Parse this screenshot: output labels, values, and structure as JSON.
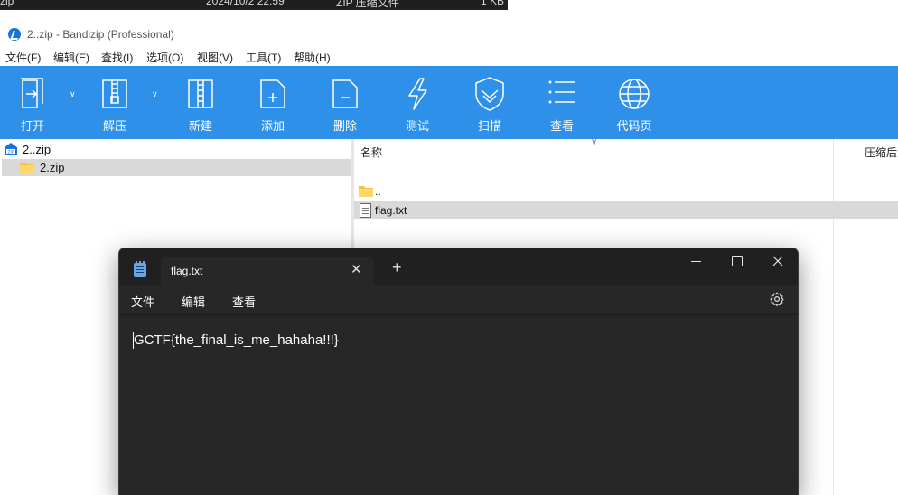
{
  "top_row": {
    "name": "zip",
    "date": "2024/10/2 22:59",
    "type": "ZIP 压缩文件",
    "size": "1 KB"
  },
  "bandizip": {
    "title": "2..zip - Bandizip (Professional)",
    "menu": [
      "文件(F)",
      "编辑(E)",
      "查找(I)",
      "选项(O)",
      "视图(V)",
      "工具(T)",
      "帮助(H)"
    ],
    "toolbar": {
      "open": "打开",
      "extract": "解压",
      "new": "新建",
      "add": "添加",
      "delete": "删除",
      "test": "测试",
      "scan": "扫描",
      "view": "查看",
      "codepage": "代码页"
    },
    "tree": {
      "root": "2..zip",
      "child": "2.zip"
    },
    "columns": {
      "name": "名称",
      "size": "压缩后大小"
    },
    "files": [
      {
        "name": ".."
      },
      {
        "name": "flag.txt"
      }
    ],
    "colors": {
      "toolbar": "#2e90e8",
      "selection": "#d9d9d9"
    }
  },
  "notepad": {
    "tab_title": "flag.txt",
    "menu": {
      "file": "文件",
      "edit": "编辑",
      "view": "查看"
    },
    "content": "GCTF{the_final_is_me_hahaha!!!}",
    "colors": {
      "background": "#272727",
      "tabbar": "#202020"
    }
  }
}
